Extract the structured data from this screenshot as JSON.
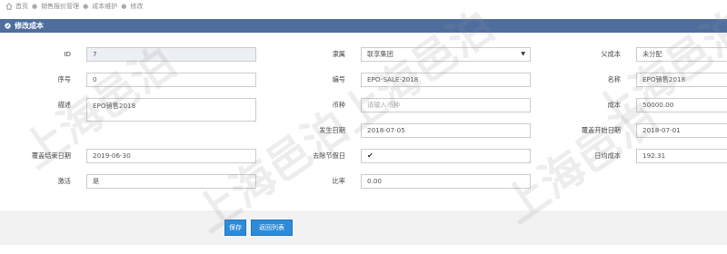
{
  "breadcrumb": {
    "items": [
      "首页",
      "销售报价管理",
      "成本维护",
      "修改"
    ]
  },
  "header": {
    "title": "修改成本"
  },
  "form": {
    "id_label": "ID",
    "id_value": "7",
    "group_label": "隶属",
    "group_value": "联享集团",
    "parent_label": "父成本",
    "parent_value": "未分配",
    "seq_label": "序号",
    "seq_value": "0",
    "code_label": "编号",
    "code_value": "EPO-SALE-2018",
    "name_label": "名称",
    "name_value": "EPO销售2018",
    "desc_label": "描述",
    "desc_value": "EPO销售2018",
    "currency_label": "币种",
    "currency_placeholder": "请输入币种",
    "cost_label": "成本",
    "cost_value": "50000.00",
    "occur_date_label": "发生日期",
    "occur_date_value": "2018-07-05",
    "cover_start_label": "覆盖开始日期",
    "cover_start_value": "2018-07-01",
    "cover_end_label": "覆盖结束日期",
    "cover_end_value": "2019-06-30",
    "exclude_holiday_label": "去除节假日",
    "exclude_holiday_checked": true,
    "daily_cost_label": "日均成本",
    "daily_cost_value": "192.31",
    "active_label": "激活",
    "active_value": "是",
    "ratio_label": "比率",
    "ratio_value": "0.00"
  },
  "buttons": {
    "save": "保存",
    "back": "返回列表"
  },
  "watermark": {
    "text": "上海邑泊"
  },
  "colors": {
    "header_bg": "#4f6e9e",
    "button_bg": "#2d8ad9",
    "footer_bg": "#f2f2f2"
  }
}
